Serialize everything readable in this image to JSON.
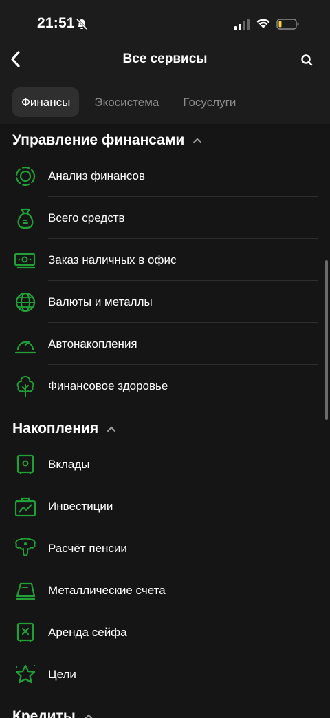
{
  "status": {
    "time": "21:51"
  },
  "header": {
    "title": "Все сервисы"
  },
  "tabs": [
    {
      "label": "Финансы",
      "active": true
    },
    {
      "label": "Экосистема",
      "active": false
    },
    {
      "label": "Госуслуги",
      "active": false
    }
  ],
  "sections": [
    {
      "title": "Управление финансами",
      "items": [
        {
          "label": "Анализ финансов",
          "icon": "donut-chart-icon"
        },
        {
          "label": "Всего средств",
          "icon": "money-bag-icon"
        },
        {
          "label": "Заказ наличных в офис",
          "icon": "banknote-icon"
        },
        {
          "label": "Валюты и металлы",
          "icon": "globe-icon"
        },
        {
          "label": "Автонакопления",
          "icon": "gauge-icon"
        },
        {
          "label": "Финансовое здоровье",
          "icon": "tree-icon"
        }
      ]
    },
    {
      "title": "Накопления",
      "items": [
        {
          "label": "Вклады",
          "icon": "safe-icon"
        },
        {
          "label": "Инвестиции",
          "icon": "briefcase-chart-icon"
        },
        {
          "label": "Расчёт пенсии",
          "icon": "pension-icon"
        },
        {
          "label": "Металлические счета",
          "icon": "gold-bar-icon"
        },
        {
          "label": "Аренда сейфа",
          "icon": "deposit-box-icon"
        },
        {
          "label": "Цели",
          "icon": "star-icon"
        }
      ]
    },
    {
      "title": "Кредиты",
      "items": []
    }
  ],
  "colors": {
    "accent": "#21a038",
    "background": "#151515",
    "header": "#1c1c1c"
  }
}
